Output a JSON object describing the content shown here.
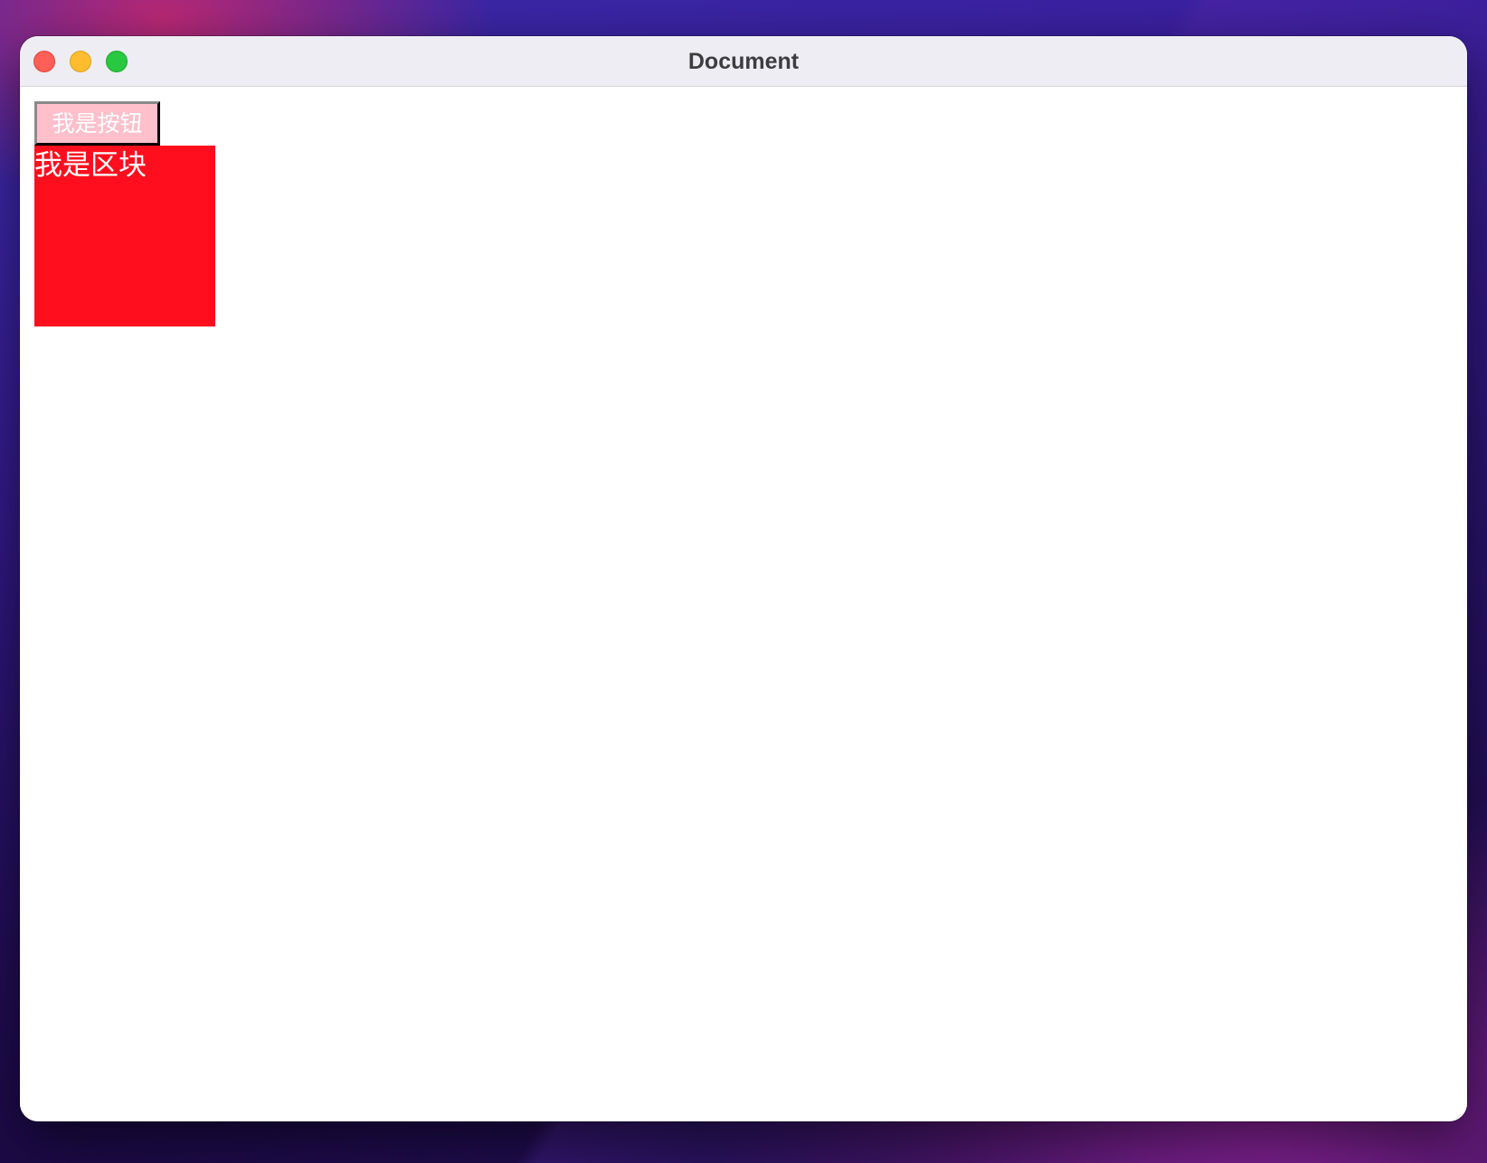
{
  "window": {
    "title": "Document"
  },
  "content": {
    "button_label": "我是按钮",
    "block_text": "我是区块"
  },
  "colors": {
    "button_background": "#ffc0cb",
    "block_background": "#ff0f1e",
    "text": "#ffffff",
    "close": "#fe5f57",
    "minimize": "#febc2e",
    "zoom": "#28c840"
  },
  "icons": {
    "close": "close-icon",
    "minimize": "minimize-icon",
    "zoom": "zoom-icon"
  }
}
